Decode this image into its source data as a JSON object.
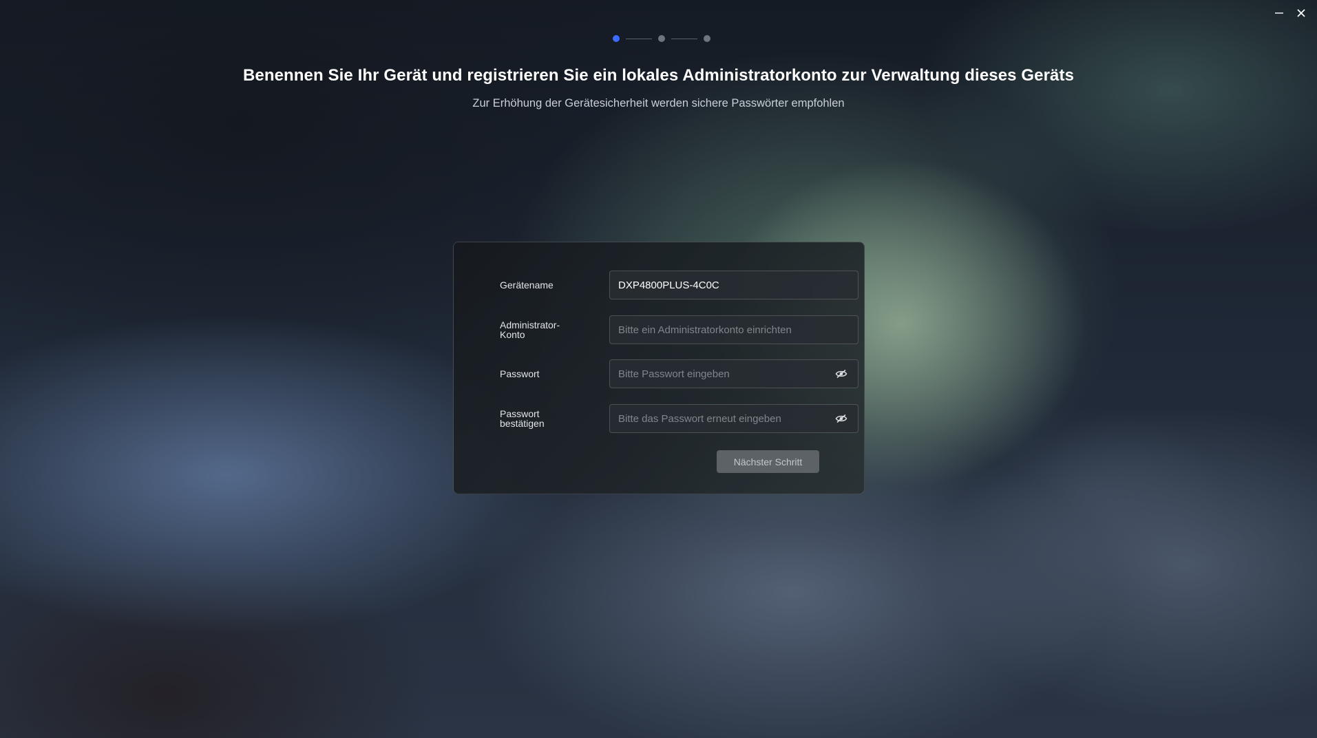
{
  "window": {
    "minimize_icon": "minimize-icon",
    "close_icon": "close-icon"
  },
  "stepper": {
    "total_steps": 3,
    "current_step": 1,
    "active_color": "#3d6bff",
    "inactive_color": "#6f757c"
  },
  "header": {
    "title": "Benennen Sie Ihr Gerät und registrieren Sie ein lokales Administratorkonto zur Verwaltung dieses Geräts",
    "subtitle": "Zur Erhöhung der Gerätesicherheit werden sichere Passwörter empfohlen"
  },
  "form": {
    "device_name": {
      "label": "Gerätename",
      "value": "DXP4800PLUS-4C0C"
    },
    "admin_account": {
      "label": "Administrator-Konto",
      "placeholder": "Bitte ein Administratorkonto einrichten"
    },
    "password": {
      "label": "Passwort",
      "placeholder": "Bitte Passwort eingeben",
      "icon": "eye-off-icon"
    },
    "confirm_password": {
      "label": "Passwort bestätigen",
      "placeholder": "Bitte das Passwort erneut eingeben",
      "icon": "eye-off-icon"
    },
    "next_button": "Nächster Schritt"
  }
}
